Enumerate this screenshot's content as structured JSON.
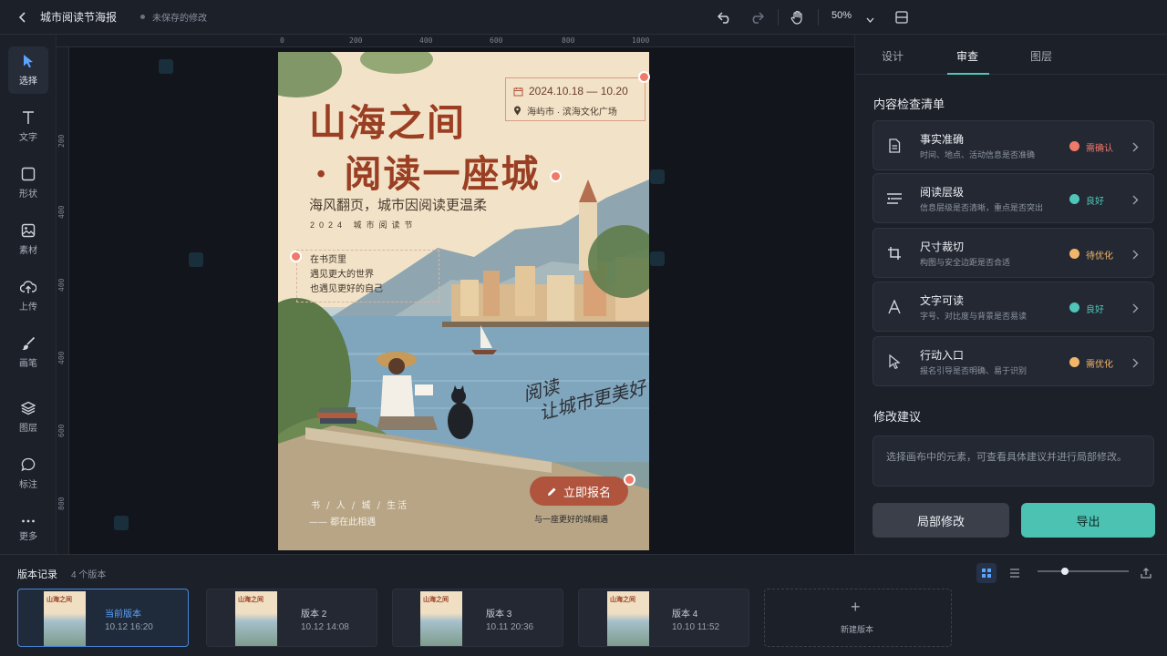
{
  "app": {
    "doc_title": "城市阅读节海报",
    "save_status": "未保存的修改",
    "zoom": "50%"
  },
  "tools": [
    {
      "label": "选择",
      "icon": "cursor-icon"
    },
    {
      "label": "文字",
      "icon": "text-icon"
    },
    {
      "label": "形状",
      "icon": "shape-icon"
    },
    {
      "label": "素材",
      "icon": "image-icon"
    },
    {
      "label": "上传",
      "icon": "upload-icon"
    },
    {
      "label": "画笔",
      "icon": "brush-icon"
    },
    {
      "label": "图层",
      "icon": "layers-icon"
    },
    {
      "label": "标注",
      "icon": "comment-icon"
    },
    {
      "label": "更多",
      "icon": "more-icon"
    }
  ],
  "rulers": {
    "top": [
      "0",
      "200",
      "400",
      "600",
      "800",
      "1000"
    ],
    "left": [
      "200",
      "400",
      "400",
      "400",
      "600",
      "800"
    ]
  },
  "poster": {
    "title_line1": "山海之间",
    "title_line2": "· 阅读一座城",
    "subtitle": "海风翻页，城市因阅读更温柔",
    "event_name": "2024 城市阅读节",
    "date": "2024.10.18 — 10.20",
    "location": "海屿市 · 滨海文化广场",
    "quote": [
      "在书页里",
      "遇见更大的世界",
      "也遇见更好的自己"
    ],
    "handwriting": [
      "阅读",
      "让城市更美好"
    ],
    "cta": "立即报名",
    "cta_sub": "与一座更好的城相遇",
    "footer1": "书 / 人 / 城 / 生活",
    "footer2": "—— 都在此相遇"
  },
  "panel": {
    "tabs": [
      "设计",
      "审查",
      "图层"
    ],
    "active_tab": "审查",
    "checklist_title": "内容检查清单",
    "checks": [
      {
        "name": "事实准确",
        "desc": "时间、地点、活动信息是否准确",
        "status": "需确认",
        "color": "#f07a6a",
        "icon": "document-icon"
      },
      {
        "name": "阅读层级",
        "desc": "信息层级是否清晰，重点是否突出",
        "status": "良好",
        "color": "#4fc6b8",
        "icon": "hierarchy-icon"
      },
      {
        "name": "尺寸裁切",
        "desc": "构图与安全边距是否合适",
        "status": "待优化",
        "color": "#f2b66b",
        "icon": "crop-icon"
      },
      {
        "name": "文字可读",
        "desc": "字号、对比度与背景是否易读",
        "status": "良好",
        "color": "#4fc6b8",
        "icon": "font-icon"
      },
      {
        "name": "行动入口",
        "desc": "报名引导是否明确、易于识别",
        "status": "需优化",
        "color": "#f2b66b",
        "icon": "pointer-icon"
      }
    ],
    "suggest_title": "修改建议",
    "suggest_placeholder": "选择画布中的元素，可查看具体建议并进行局部修改。",
    "btn_local": "局部修改",
    "btn_export": "导出"
  },
  "versions": {
    "title": "版本记录",
    "count": "4 个版本",
    "items": [
      {
        "name": "当前版本",
        "time": "10.12 16:20"
      },
      {
        "name": "版本 2",
        "time": "10.12 14:08"
      },
      {
        "name": "版本 3",
        "time": "10.11 20:36"
      },
      {
        "name": "版本 4",
        "time": "10.10 11:52"
      }
    ],
    "new_label": "新建版本"
  }
}
